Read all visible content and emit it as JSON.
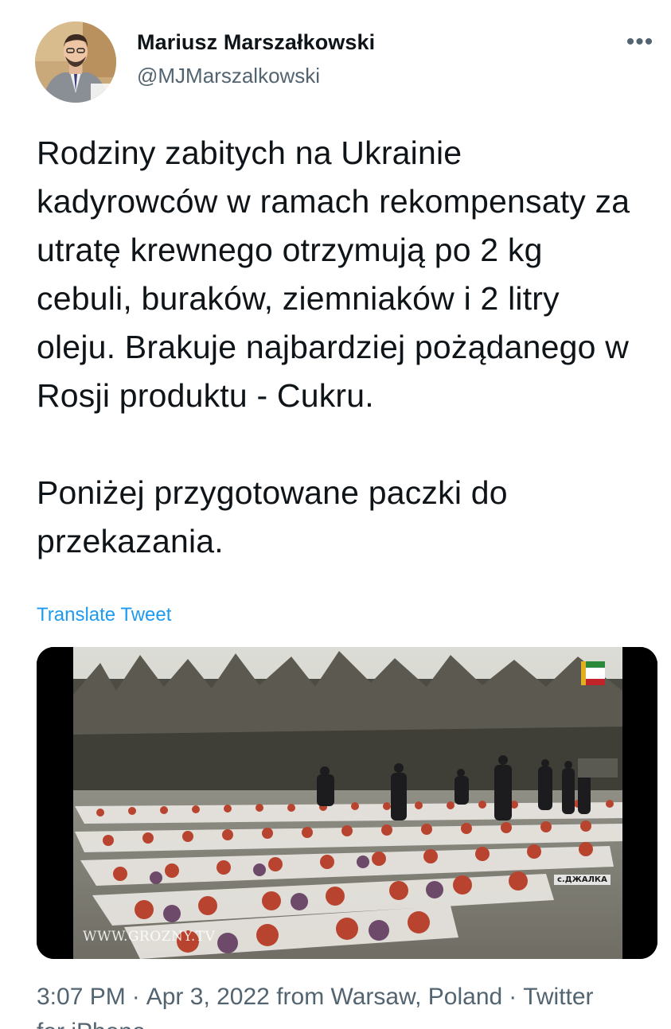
{
  "author": {
    "name": "Mariusz Marszałkowski",
    "handle": "@MJMarszalkowski",
    "avatar_icon": "profile-photo"
  },
  "more_icon": "more-horizontal-icon",
  "more_label": "•••",
  "tweet": {
    "paragraph1": "Rodziny zabitych na Ukrainie kadyrowców w ramach rekompensaty za utratę krewnego otrzymują po 2 kg cebuli, buraków, ziemniaków i 2 litry oleju. Brakuje najbardziej pożądanego w Rosji produktu - Cukru.",
    "paragraph2": "Poniżej przygotowane paczki do przekazania.",
    "translate_label": "Translate Tweet"
  },
  "media": {
    "watermark": "WWW.GROZNY.TV",
    "location_caption": "с.ДЖАЛКА"
  },
  "meta": {
    "time": "3:07 PM",
    "date": "Apr 3, 2022",
    "location": "from Warsaw, Poland",
    "source": "Twitter",
    "source_cut": "for iPhone",
    "separator": "·"
  },
  "colors": {
    "link": "#1d9bf0",
    "secondary_text": "#536471",
    "primary_text": "#0f1419"
  }
}
